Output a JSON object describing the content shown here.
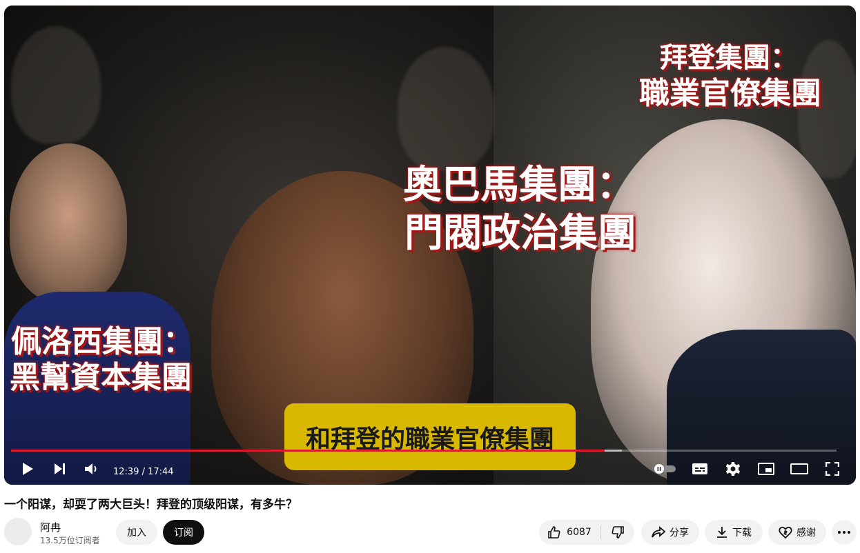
{
  "video": {
    "captions": {
      "biden_line1": "拜登集團：",
      "biden_line2": "職業官僚集團",
      "obama_line1": "奧巴馬集團：",
      "obama_line2": "門閥政治集團",
      "pelosi_line1": "佩洛西集團：",
      "pelosi_line2": "黑幫資本集團"
    },
    "subtitle": "和拜登的職業官僚集團",
    "progress_fraction": 0.719,
    "buffered_fraction": 0.74
  },
  "player": {
    "time_display": "12:39 / 17:44",
    "icons": {
      "play": "play-icon",
      "next": "next-icon",
      "volume": "volume-icon",
      "autoplay": "autoplay-toggle-icon",
      "subtitles": "subtitles-icon",
      "settings": "settings-icon",
      "miniplayer": "miniplayer-icon",
      "theater": "theater-icon",
      "fullscreen": "fullscreen-icon"
    }
  },
  "meta": {
    "title": "一个阳谋，却耍了两大巨头！拜登的顶级阳谋，有多牛？",
    "channel_name": "阿冉",
    "subscriber_count": "13.5万位订阅者",
    "join_label": "加入",
    "subscribe_label": "订阅"
  },
  "actions": {
    "like_count": "6087",
    "share_label": "分享",
    "download_label": "下载",
    "thanks_label": "感谢"
  },
  "colors": {
    "progress_played": "#e01a2d",
    "caption_shadow": "#a01818",
    "subtitle_bg": "#d8b900"
  }
}
